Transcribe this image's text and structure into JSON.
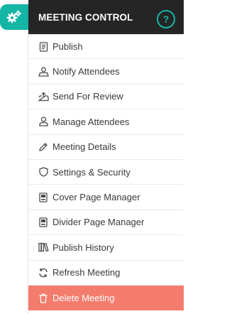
{
  "panel": {
    "title": "MEETING CONTROL",
    "help_label": "?"
  },
  "toggle": {
    "icon": "gears-icon"
  },
  "colors": {
    "accent": "#13b5a4",
    "header_bg": "#252525",
    "danger_bg": "#f47c6d"
  },
  "menu": {
    "items": [
      {
        "label": "Publish",
        "icon": "document-icon"
      },
      {
        "label": "Notify Attendees",
        "icon": "notify-icon"
      },
      {
        "label": "Send For Review",
        "icon": "inbox-upload-icon"
      },
      {
        "label": "Manage Attendees",
        "icon": "user-icon"
      },
      {
        "label": "Meeting Details",
        "icon": "pencil-icon"
      },
      {
        "label": "Settings & Security",
        "icon": "shield-icon"
      },
      {
        "label": "Cover Page Manager",
        "icon": "id-card-icon"
      },
      {
        "label": "Divider Page Manager",
        "icon": "id-card-icon"
      },
      {
        "label": "Publish History",
        "icon": "books-icon"
      },
      {
        "label": "Refresh Meeting",
        "icon": "refresh-icon"
      },
      {
        "label": "Delete Meeting",
        "icon": "trash-icon"
      }
    ]
  }
}
